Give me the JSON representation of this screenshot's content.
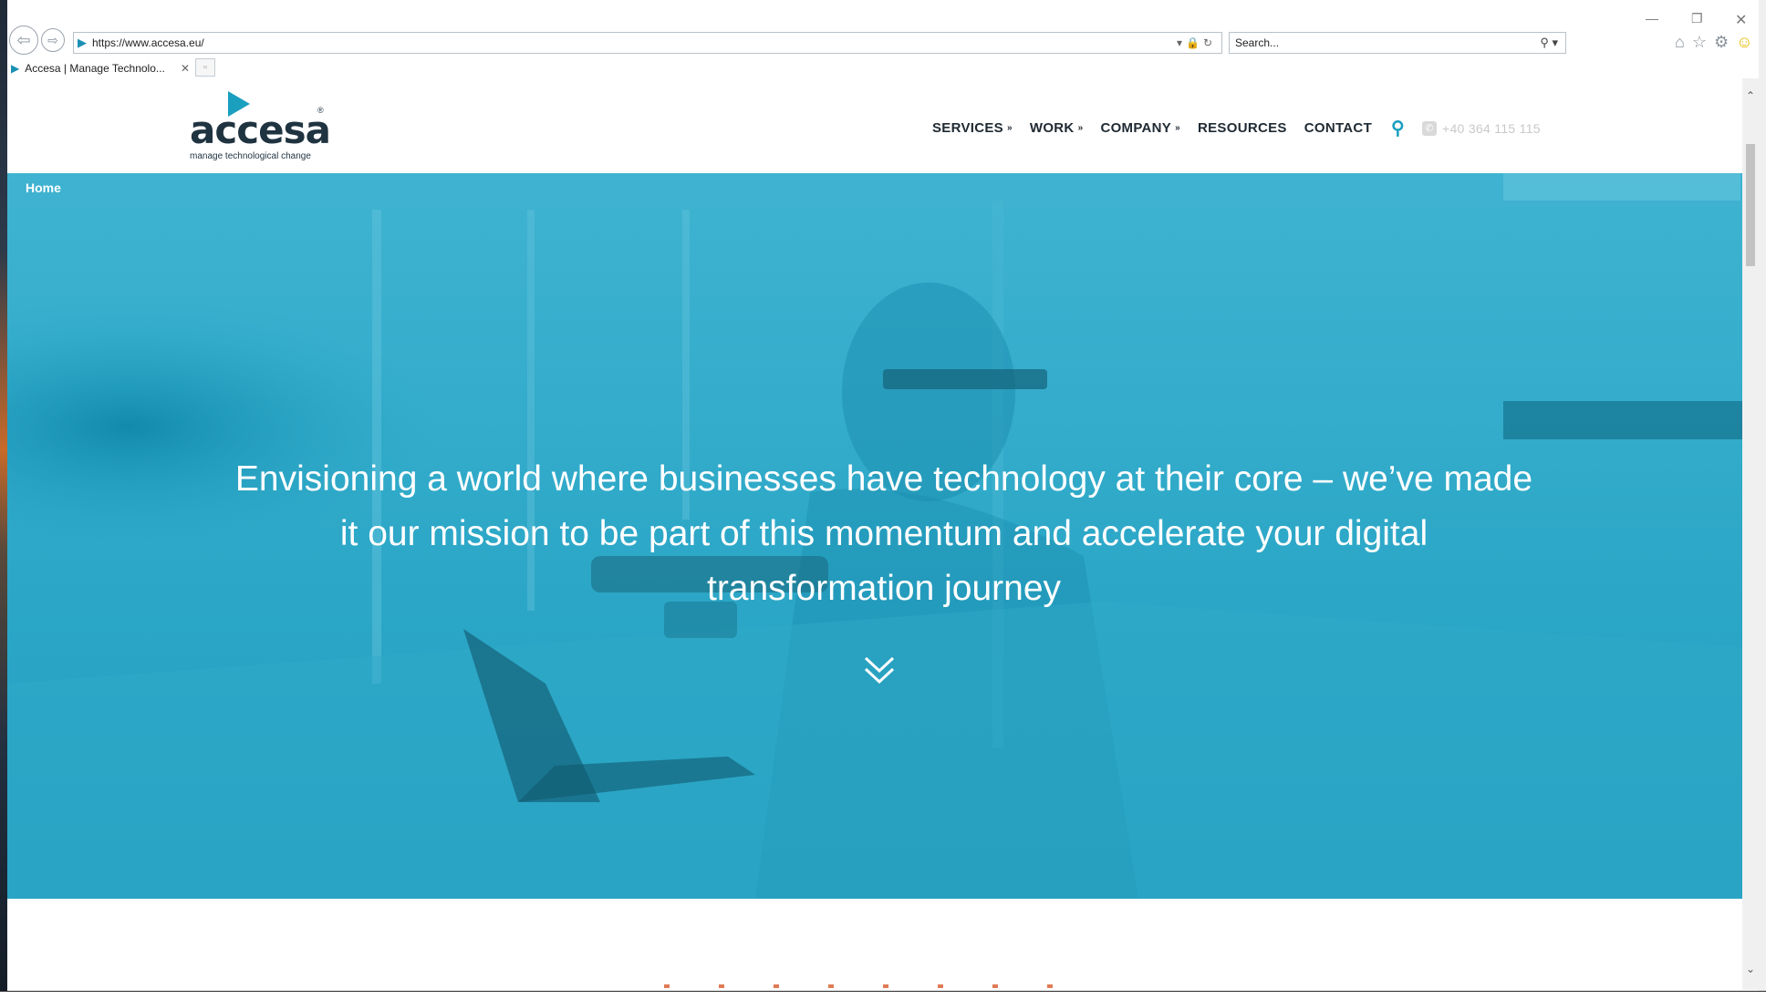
{
  "browser": {
    "url": "https://www.accesa.eu/",
    "search_placeholder": "Search...",
    "tab_title": "Accesa | Manage Technolo...",
    "icons": [
      "back-arrow-icon",
      "forward-arrow-icon",
      "lock-icon",
      "refresh-icon",
      "search-icon",
      "home-icon",
      "star-icon",
      "gear-icon",
      "smiley-icon",
      "close-icon",
      "minimize-icon",
      "restore-icon"
    ]
  },
  "site": {
    "logo_word": "accesa",
    "logo_tagline": "manage technological change",
    "nav": [
      {
        "label": "SERVICES",
        "has_dropdown": true
      },
      {
        "label": "WORK",
        "has_dropdown": true
      },
      {
        "label": "COMPANY",
        "has_dropdown": true
      },
      {
        "label": "RESOURCES",
        "has_dropdown": false
      },
      {
        "label": "CONTACT",
        "has_dropdown": false
      }
    ],
    "phone": "+40 364 115 115",
    "accent_color": "#1b9fbf",
    "breadcrumb": "Home",
    "hero_text": "Envisioning a world where businesses have technology at their core – we’ve made it our mission to be part of this momentum and accelerate your digital transformation journey"
  }
}
